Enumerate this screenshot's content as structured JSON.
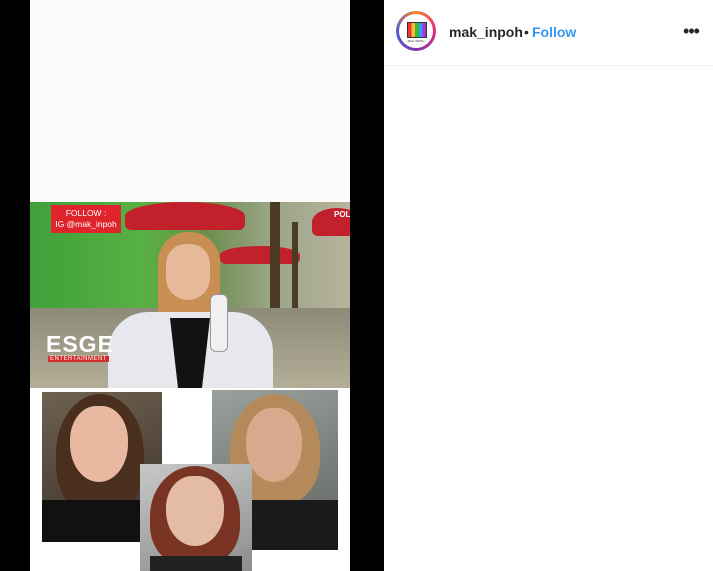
{
  "post": {
    "username": "mak_inpoh",
    "separator": "•",
    "follow_label": "Follow",
    "avatar_caption": "MAK INPOH",
    "more_icon": "more-horizontal-icon"
  },
  "media": {
    "overlay_follow_line1": "FOLLOW :",
    "overlay_follow_line2": "IG @mak_inpoh",
    "logo_text": "ESGE",
    "logo_subtext": "ENTERTAINMENT",
    "umbrella_text": "POL"
  },
  "colors": {
    "follow_blue": "#3897f0",
    "overlay_red": "#e0242c",
    "pane_black": "#000000"
  }
}
